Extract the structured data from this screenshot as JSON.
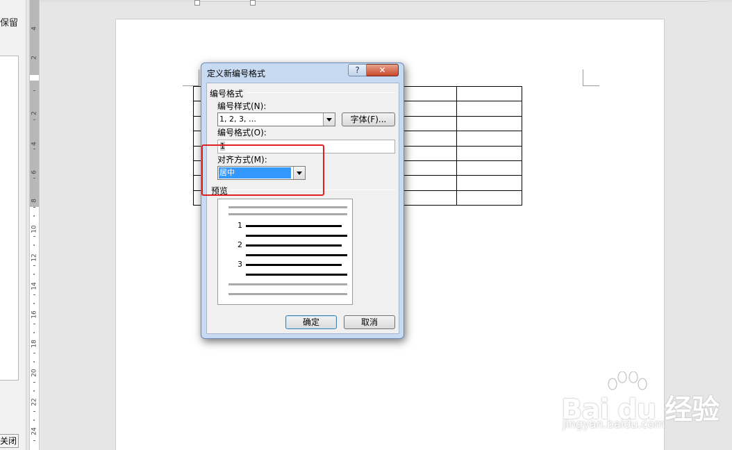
{
  "left_pane": {
    "retain_text": "保留",
    "close_label": "关闭"
  },
  "ruler": {
    "labels": [
      "4",
      "2",
      "2",
      "4",
      "6",
      "8",
      "10",
      "12",
      "14",
      "16",
      "18",
      "20",
      "22",
      "24"
    ]
  },
  "dialog": {
    "title": "定义新编号格式",
    "help_label": "?",
    "close_label": "✕",
    "group_number_format": "编号格式",
    "number_style_label": "编号样式(N):",
    "number_style_value": "1, 2, 3, …",
    "font_button_label": "字体(F)...",
    "number_format_label": "编号格式(O):",
    "number_format_value": "1",
    "alignment_label": "对齐方式(M):",
    "alignment_value": "居中",
    "preview_label": "预览",
    "preview_numbers": [
      "1",
      "2",
      "3"
    ],
    "ok_label": "确定",
    "cancel_label": "取消"
  },
  "watermark": {
    "brand": "Bai  du 经验",
    "url": "jingyan.baidu.com"
  },
  "colors": {
    "highlight": "#e02020",
    "selection": "#3399ff",
    "dialog_frame": "#c8daf1"
  }
}
